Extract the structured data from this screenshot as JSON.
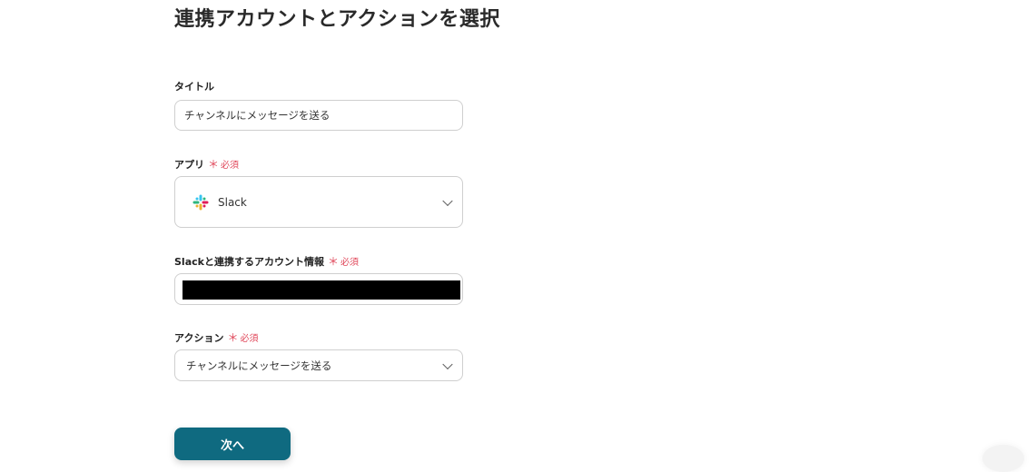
{
  "page": {
    "title": "連携アカウントとアクションを選択"
  },
  "title_field": {
    "label": "タイトル",
    "value": "チャンネルにメッセージを送る"
  },
  "app_field": {
    "label": "アプリ",
    "required": "必須",
    "required_mark": "＊",
    "value": "Slack",
    "icon": "slack-icon"
  },
  "account_field": {
    "label": "Slackと連携するアカウント情報",
    "required": "必須",
    "required_mark": "＊",
    "value_redacted": true
  },
  "action_field": {
    "label": "アクション",
    "required": "必須",
    "required_mark": "＊",
    "value": "チャンネルにメッセージを送る"
  },
  "next_button": {
    "label": "次へ"
  },
  "colors": {
    "primary": "#0f6a80",
    "required": "#e0475a",
    "border": "#cfcfcf"
  }
}
